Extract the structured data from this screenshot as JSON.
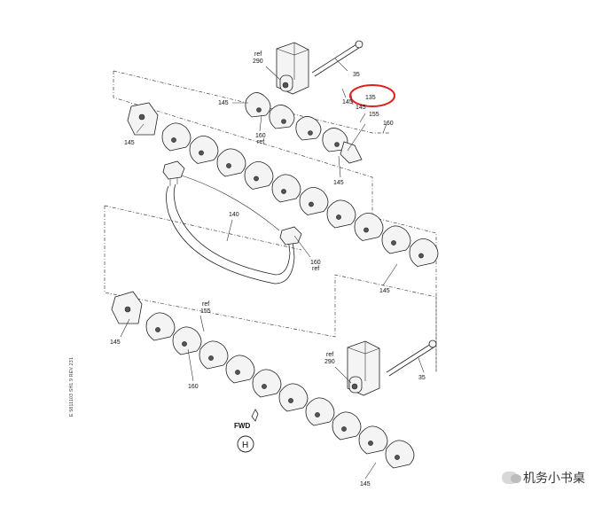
{
  "callouts": {
    "c35_top": "35",
    "ref_top_a": "ref",
    "c290_top": "290",
    "c145_a": "145",
    "c145_b": "145",
    "c145_c": "145",
    "c145_d": "145",
    "c145_e": "145",
    "c145_f": "145",
    "c145_g": "145",
    "c160_a": "160",
    "ref_160_a": "ref",
    "c160_b": "160",
    "c135": "135",
    "c145_h": "145",
    "c155": "155",
    "c160_c": "160",
    "c140": "140",
    "c160_d": "160",
    "ref_160_d": "ref",
    "ref_155": "ref",
    "c155_b": "155",
    "c160_e": "160",
    "ref_290_b": "ref",
    "c290_b": "290",
    "c35_b": "35"
  },
  "direction_label": "FWD",
  "zone_letter": "H",
  "drawing_code": "E 5811103  SH1  9  REV 231",
  "watermark": "机务小书桌",
  "colors": {
    "highlight": "#e0201c",
    "line": "#222222"
  },
  "icons": {
    "forward_arrow": "fwd-arrow-icon",
    "watermark_logo": "wechat-logo-icon"
  }
}
